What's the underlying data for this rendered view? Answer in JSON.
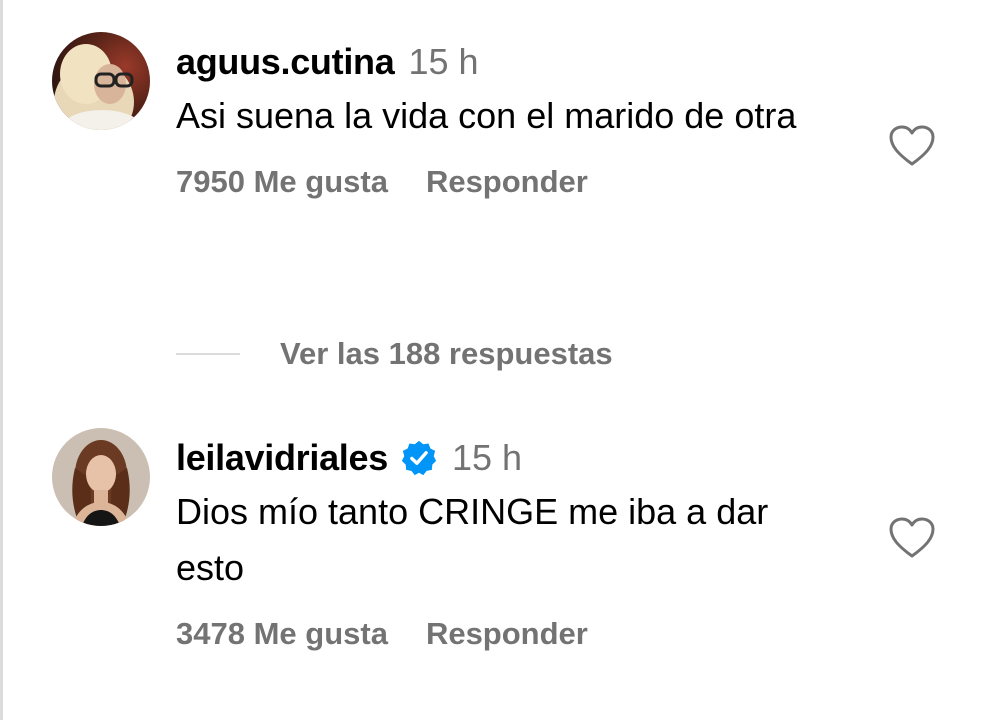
{
  "colors": {
    "primary_text": "#000000",
    "secondary_text": "#737373",
    "divider": "#dbdbdb",
    "verified_badge": "#0095f6"
  },
  "comments": [
    {
      "username": "aguus.cutina",
      "verified": false,
      "time": "15 h",
      "text": "Asi suena la vida con el marido de otra",
      "likes": "7950 Me gusta",
      "reply_label": "Responder",
      "avatar_icon": "avatar-photo",
      "like_icon": "heart-outline-icon"
    },
    {
      "username": "leilavidriales",
      "verified": true,
      "time": "15 h",
      "text": "Dios mío tanto CRINGE me iba a dar esto",
      "likes": "3478 Me gusta",
      "reply_label": "Responder",
      "avatar_icon": "avatar-photo",
      "like_icon": "heart-outline-icon"
    }
  ],
  "view_replies": {
    "label": "Ver las 188 respuestas"
  }
}
